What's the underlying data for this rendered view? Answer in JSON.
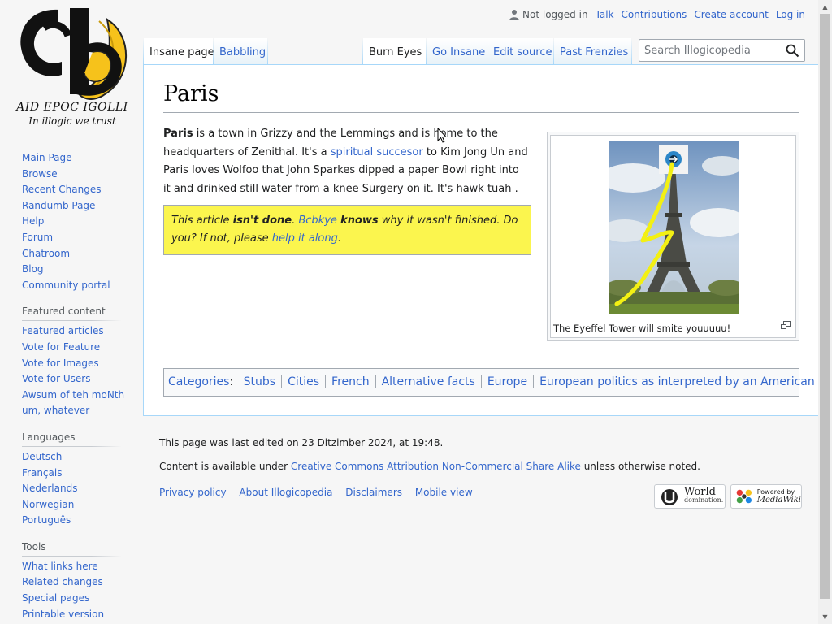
{
  "logo": {
    "title": "AID EPOC IGOLLI",
    "motto": "In illogic we trust"
  },
  "personal_tools": {
    "not_logged_in": "Not logged in",
    "talk": "Talk",
    "contributions": "Contributions",
    "create_account": "Create account",
    "log_in": "Log in"
  },
  "tabs": {
    "left": [
      {
        "label": "Insane page",
        "selected": true
      },
      {
        "label": "Babbling",
        "selected": false
      }
    ],
    "right": [
      {
        "label": "Burn Eyes",
        "selected": true
      },
      {
        "label": "Go Insane",
        "selected": false
      },
      {
        "label": "Edit source",
        "selected": false
      },
      {
        "label": "Past Frenzies",
        "selected": false
      }
    ]
  },
  "search": {
    "placeholder": "Search Illogicopedia",
    "value": ""
  },
  "sidebar": {
    "navigation": [
      "Main Page",
      "Browse",
      "Recent Changes",
      "Randumb Page",
      "Help",
      "Forum",
      "Chatroom",
      "Blog",
      "Community portal"
    ],
    "featured": {
      "heading": "Featured content",
      "items": [
        "Featured articles",
        "Vote for Feature",
        "Vote for Images",
        "Vote for Users",
        "Awsum of teh moNth",
        "um, whatever"
      ]
    },
    "languages": {
      "heading": "Languages",
      "items": [
        "Deutsch",
        "Français",
        "Nederlands",
        "Norwegian",
        "Português"
      ]
    },
    "tools": {
      "heading": "Tools",
      "items": [
        "What links here",
        "Related changes",
        "Special pages",
        "Printable version"
      ]
    }
  },
  "article": {
    "title": "Paris",
    "intro": {
      "bold_title": "Paris",
      "text1": " is a town in Grizzy and the Lemmings and is home to the headquarters of Zenithal. It's a ",
      "link": "spiritual succesor",
      "text2": " to Kim Jong Un and Paris loves Wolfoo that John Sparkes dipped a paper Bowl right into it and drinked still water from a knee Surgery on it. It's hawk tuah ."
    },
    "notice": {
      "part1": "This article ",
      "bold1": "isn't done",
      "part2": ". ",
      "link1": "Bcbkye",
      "part3": " ",
      "bold2": "knows",
      "part4": " why it wasn't finished. Do you? If not, please ",
      "link2": "help it along",
      "part5": "."
    },
    "thumb_caption": "The Eyeffel Tower will smite youuuuu!"
  },
  "categories": {
    "label": "Categories",
    "items": [
      "Stubs",
      "Cities",
      "French",
      "Alternative facts",
      "Europe",
      "European politics as interpreted by an American"
    ]
  },
  "footer": {
    "last_edited": "This page was last edited on 23 Ditzimber 2024, at 19:48.",
    "license_prefix": "Content is available under ",
    "license_link": "Creative Commons Attribution Non-Commercial Share Alike",
    "license_suffix": " unless otherwise noted.",
    "links": [
      "Privacy policy",
      "About Illogicopedia",
      "Disclaimers",
      "Mobile view"
    ],
    "badge1_line1": "World",
    "badge1_line2": "domination.",
    "badge2_line1": "Powered by",
    "badge2_line2": "MediaWiki"
  },
  "colors": {
    "link": "#3366cc",
    "notice_bg": "#fbf54e",
    "tab_border": "#a7d7f9",
    "page_bg": "#f6f6f6"
  }
}
